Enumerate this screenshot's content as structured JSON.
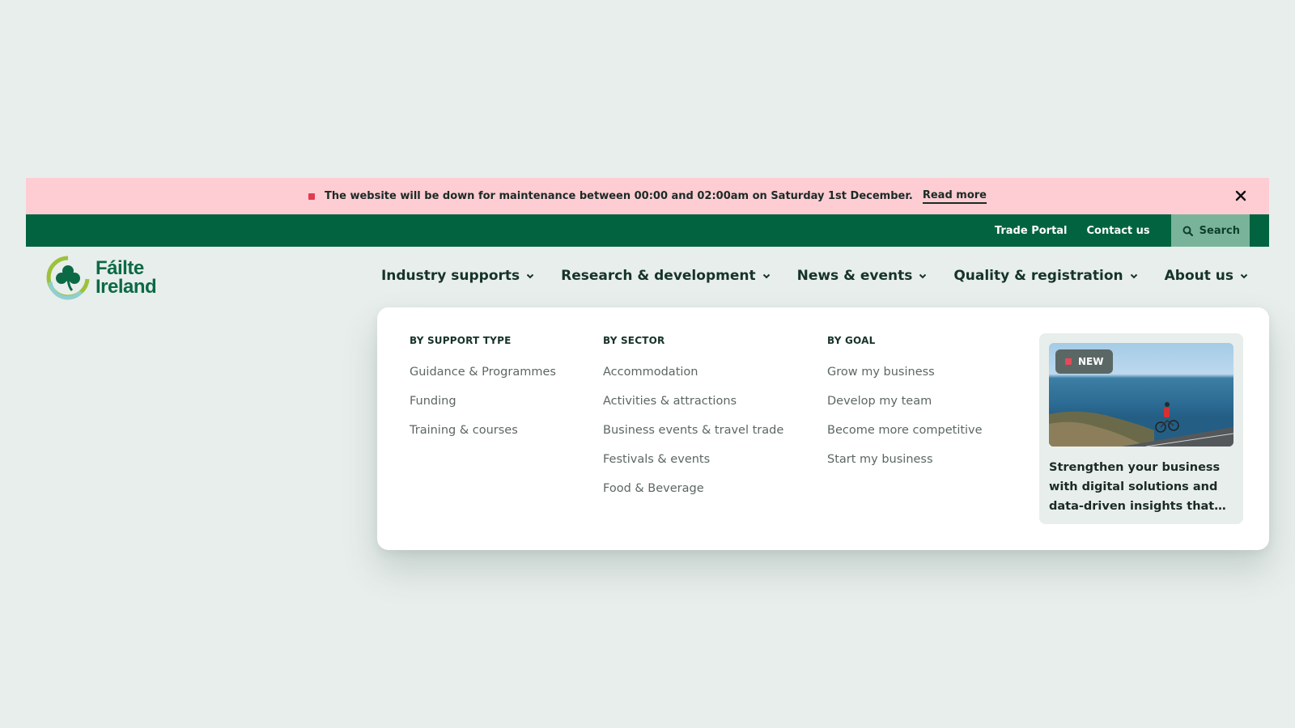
{
  "alert": {
    "message": "The website will be down for maintenance between 00:00 and 02:00am on Saturday 1st December.",
    "link": "Read more"
  },
  "utility": {
    "trade_portal": "Trade Portal",
    "contact": "Contact us",
    "search": "Search"
  },
  "logo": {
    "line1": "Fáilte",
    "line2": "Ireland"
  },
  "nav": {
    "items": [
      {
        "label": "Industry supports"
      },
      {
        "label": "Research & development"
      },
      {
        "label": "News & events"
      },
      {
        "label": "Quality & registration"
      },
      {
        "label": "About us"
      }
    ]
  },
  "dropdown": {
    "columns": [
      {
        "heading": "BY SUPPORT TYPE",
        "links": [
          "Guidance & Programmes",
          "Funding",
          "Training & courses"
        ]
      },
      {
        "heading": "BY SECTOR",
        "links": [
          "Accommodation",
          "Activities & attractions",
          "Business events & travel trade",
          "Festivals & events",
          "Food & Beverage"
        ]
      },
      {
        "heading": "BY GOAL",
        "links": [
          "Grow my business",
          "Develop my team",
          "Become more competitive",
          "Start my business"
        ]
      }
    ],
    "promo": {
      "badge": "NEW",
      "text": "Strengthen your business with digital solutions and data-driven insights that su..."
    }
  },
  "colors": {
    "brand_green": "#016340",
    "alert_bg": "#fdcdd3",
    "search_bg": "#79b49a",
    "page_bg": "#e8eeec"
  }
}
